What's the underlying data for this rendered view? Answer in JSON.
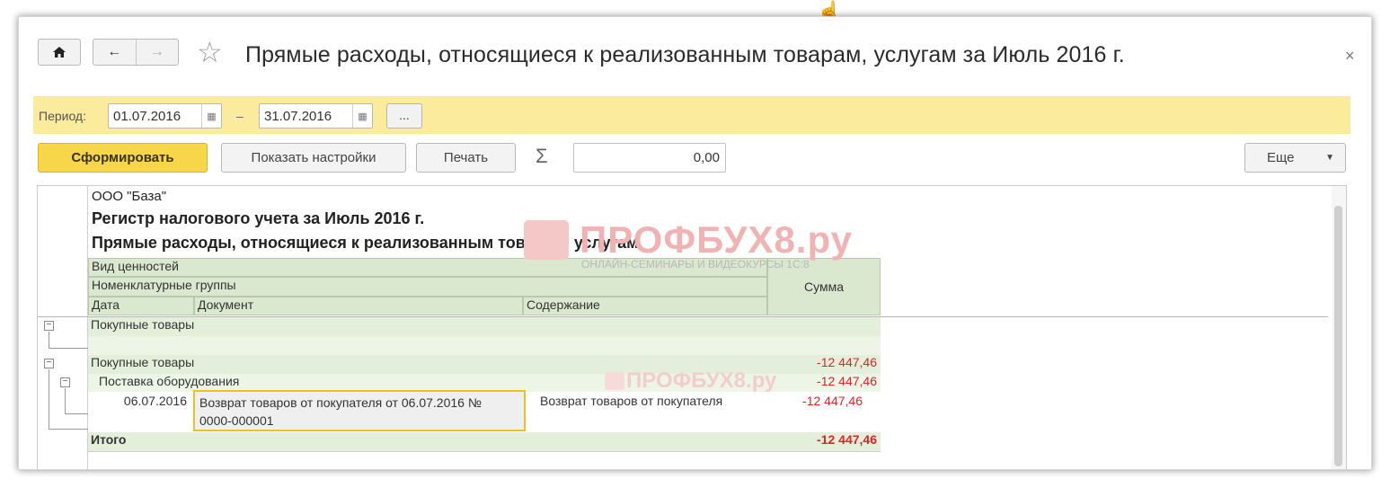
{
  "window": {
    "title": "Прямые расходы, относящиеся к реализованным товарам, услугам за Июль 2016 г.",
    "close_glyph": "×"
  },
  "nav": {
    "home_icon": "home-icon",
    "back_glyph": "←",
    "forward_glyph": "→",
    "star_glyph": "☆"
  },
  "period": {
    "label": "Период:",
    "from": "01.07.2016",
    "separator": "–",
    "to": "31.07.2016",
    "choose_label": "..."
  },
  "toolbar": {
    "generate_label": "Сформировать",
    "settings_label": "Показать настройки",
    "print_label": "Печать",
    "sigma": "Σ",
    "sum_value": "0,00",
    "more_label": "Еще",
    "more_arrow": "▼"
  },
  "report": {
    "org": "ООО \"База\"",
    "heading1": "Регистр налогового учета за Июль 2016 г.",
    "heading2": "Прямые расходы, относящиеся к реализованным товарам, услугам",
    "columns": {
      "value_type": "Вид ценностей",
      "nomenclature_groups": "Номенклатурные группы",
      "date": "Дата",
      "document": "Документ",
      "content": "Содержание",
      "sum": "Сумма"
    },
    "rows": {
      "group1": "Покупные товары",
      "group2": "Покупные товары",
      "group2_sum": "-12 447,46",
      "subgroup": "Поставка оборудования",
      "subgroup_sum": "-12 447,46",
      "detail_date": "06.07.2016",
      "detail_document_line1": "Возврат товаров от покупателя от 06.07.2016 №",
      "detail_document_line2": "0000-000001",
      "detail_content": "Возврат товаров от покупателя",
      "detail_sum": "-12 447,46",
      "total_label": "Итого",
      "total_sum": "-12 447,46"
    }
  },
  "watermark": {
    "text": "ПРОФБУХ8.ру",
    "subtitle": "ОНЛАЙН-СЕМИНАРЫ И ВИДЕОКУРСЫ 1С:8"
  },
  "colors": {
    "period_band": "#fbeb9d",
    "primary_button": "#f7d64a",
    "table_header": "#d9e8cf",
    "negative_amount": "#e02424",
    "highlight_border": "#efc21b"
  }
}
